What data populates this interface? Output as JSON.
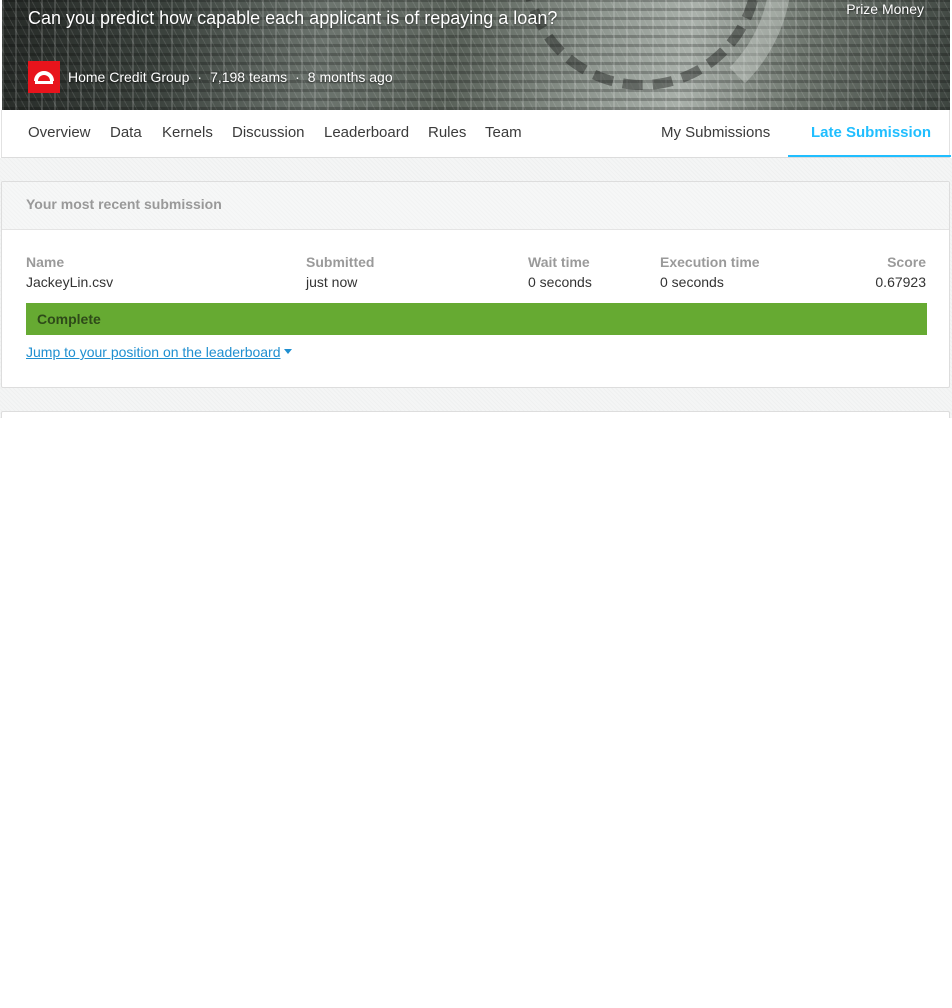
{
  "header": {
    "title": "Can you predict how capable each applicant is of repaying a loan?",
    "prize_label": "Prize Money",
    "host": "Home Credit Group",
    "teams": "7,198 teams",
    "time_ago": "8 months ago",
    "logo_color": "#e8141c"
  },
  "tabs": {
    "left": [
      "Overview",
      "Data",
      "Kernels",
      "Discussion",
      "Leaderboard",
      "Rules",
      "Team"
    ],
    "my_submissions": "My Submissions",
    "late_submission": "Late Submission",
    "active_color": "#20beff"
  },
  "submission": {
    "heading": "Your most recent submission",
    "columns": {
      "name": "Name",
      "submitted": "Submitted",
      "wait_time": "Wait time",
      "execution_time": "Execution time",
      "score": "Score"
    },
    "values": {
      "name": "JackeyLin.csv",
      "submitted": "just now",
      "wait_time": "0 seconds",
      "execution_time": "0 seconds",
      "score": "0.67923"
    },
    "status": "Complete",
    "status_color": "#66aa32",
    "jump_link": "Jump to your position on the leaderboard"
  }
}
